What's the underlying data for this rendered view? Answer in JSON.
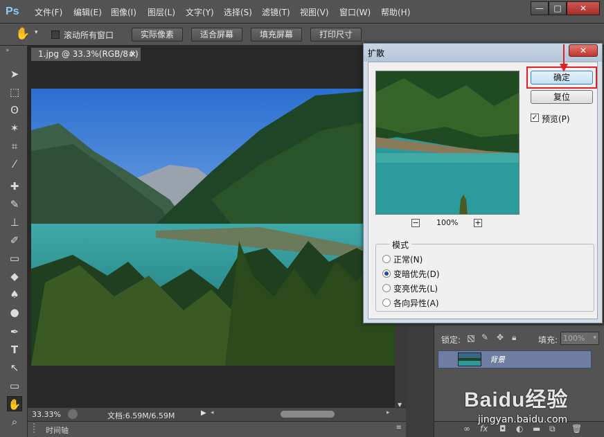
{
  "app": {
    "logo": "Ps"
  },
  "menu": [
    "文件(F)",
    "编辑(E)",
    "图像(I)",
    "图层(L)",
    "文字(Y)",
    "选择(S)",
    "滤镜(T)",
    "视图(V)",
    "窗口(W)",
    "帮助(H)"
  ],
  "window_controls": {
    "minimize": "—",
    "maximize": "□",
    "close": "✕"
  },
  "options_bar": {
    "scroll_all_label": "滚动所有窗口",
    "scroll_all_checked": false,
    "buttons": [
      "实际像素",
      "适合屏幕",
      "填充屏幕",
      "打印尺寸"
    ]
  },
  "document": {
    "tab_title": "1.jpg @ 33.3%(RGB/8#)",
    "tab_close": "×",
    "zoom": "33.33%",
    "doc_size": "文档:6.59M/6.59M",
    "timeline_label": "时间轴"
  },
  "dialog": {
    "title": "扩散",
    "close": "✕",
    "ok_label": "确定",
    "reset_label": "复位",
    "preview_label": "预览(P)",
    "preview_checked": true,
    "zoom": "100%",
    "zoom_out": "−",
    "zoom_in": "+",
    "mode_group": "模式",
    "modes": [
      {
        "label": "正常(N)",
        "selected": false
      },
      {
        "label": "变暗优先(D)",
        "selected": true
      },
      {
        "label": "变亮优先(L)",
        "selected": false
      },
      {
        "label": "各向异性(A)",
        "selected": false
      }
    ]
  },
  "layers_panel": {
    "lock_label": "锁定:",
    "fill_label": "填充:",
    "fill_value": "100%",
    "layer_name": "背景"
  },
  "watermark": {
    "brand": "Baidu经验",
    "url": "jingyan.baidu.com"
  },
  "colors": {
    "highlight_box": "#e0212a",
    "ui_dark": "#535353"
  }
}
